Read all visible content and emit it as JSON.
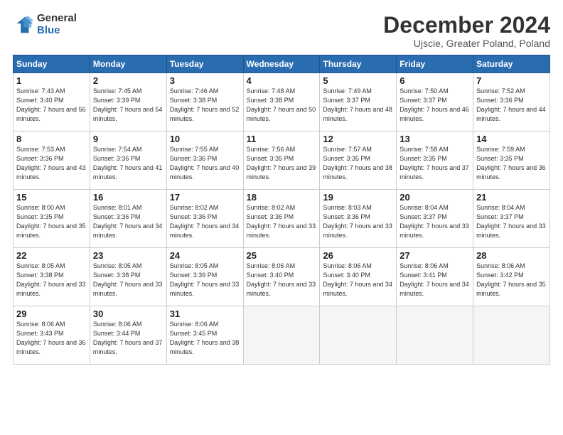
{
  "logo": {
    "general": "General",
    "blue": "Blue"
  },
  "title": "December 2024",
  "subtitle": "Ujscie, Greater Poland, Poland",
  "weekdays": [
    "Sunday",
    "Monday",
    "Tuesday",
    "Wednesday",
    "Thursday",
    "Friday",
    "Saturday"
  ],
  "weeks": [
    [
      {
        "day": "1",
        "sunrise": "7:43 AM",
        "sunset": "3:40 PM",
        "daylight": "7 hours and 56 minutes."
      },
      {
        "day": "2",
        "sunrise": "7:45 AM",
        "sunset": "3:39 PM",
        "daylight": "7 hours and 54 minutes."
      },
      {
        "day": "3",
        "sunrise": "7:46 AM",
        "sunset": "3:38 PM",
        "daylight": "7 hours and 52 minutes."
      },
      {
        "day": "4",
        "sunrise": "7:48 AM",
        "sunset": "3:38 PM",
        "daylight": "7 hours and 50 minutes."
      },
      {
        "day": "5",
        "sunrise": "7:49 AM",
        "sunset": "3:37 PM",
        "daylight": "7 hours and 48 minutes."
      },
      {
        "day": "6",
        "sunrise": "7:50 AM",
        "sunset": "3:37 PM",
        "daylight": "7 hours and 46 minutes."
      },
      {
        "day": "7",
        "sunrise": "7:52 AM",
        "sunset": "3:36 PM",
        "daylight": "7 hours and 44 minutes."
      }
    ],
    [
      {
        "day": "8",
        "sunrise": "7:53 AM",
        "sunset": "3:36 PM",
        "daylight": "7 hours and 43 minutes."
      },
      {
        "day": "9",
        "sunrise": "7:54 AM",
        "sunset": "3:36 PM",
        "daylight": "7 hours and 41 minutes."
      },
      {
        "day": "10",
        "sunrise": "7:55 AM",
        "sunset": "3:36 PM",
        "daylight": "7 hours and 40 minutes."
      },
      {
        "day": "11",
        "sunrise": "7:56 AM",
        "sunset": "3:35 PM",
        "daylight": "7 hours and 39 minutes."
      },
      {
        "day": "12",
        "sunrise": "7:57 AM",
        "sunset": "3:35 PM",
        "daylight": "7 hours and 38 minutes."
      },
      {
        "day": "13",
        "sunrise": "7:58 AM",
        "sunset": "3:35 PM",
        "daylight": "7 hours and 37 minutes."
      },
      {
        "day": "14",
        "sunrise": "7:59 AM",
        "sunset": "3:35 PM",
        "daylight": "7 hours and 36 minutes."
      }
    ],
    [
      {
        "day": "15",
        "sunrise": "8:00 AM",
        "sunset": "3:35 PM",
        "daylight": "7 hours and 35 minutes."
      },
      {
        "day": "16",
        "sunrise": "8:01 AM",
        "sunset": "3:36 PM",
        "daylight": "7 hours and 34 minutes."
      },
      {
        "day": "17",
        "sunrise": "8:02 AM",
        "sunset": "3:36 PM",
        "daylight": "7 hours and 34 minutes."
      },
      {
        "day": "18",
        "sunrise": "8:02 AM",
        "sunset": "3:36 PM",
        "daylight": "7 hours and 33 minutes."
      },
      {
        "day": "19",
        "sunrise": "8:03 AM",
        "sunset": "3:36 PM",
        "daylight": "7 hours and 33 minutes."
      },
      {
        "day": "20",
        "sunrise": "8:04 AM",
        "sunset": "3:37 PM",
        "daylight": "7 hours and 33 minutes."
      },
      {
        "day": "21",
        "sunrise": "8:04 AM",
        "sunset": "3:37 PM",
        "daylight": "7 hours and 33 minutes."
      }
    ],
    [
      {
        "day": "22",
        "sunrise": "8:05 AM",
        "sunset": "3:38 PM",
        "daylight": "7 hours and 33 minutes."
      },
      {
        "day": "23",
        "sunrise": "8:05 AM",
        "sunset": "3:38 PM",
        "daylight": "7 hours and 33 minutes."
      },
      {
        "day": "24",
        "sunrise": "8:05 AM",
        "sunset": "3:39 PM",
        "daylight": "7 hours and 33 minutes."
      },
      {
        "day": "25",
        "sunrise": "8:06 AM",
        "sunset": "3:40 PM",
        "daylight": "7 hours and 33 minutes."
      },
      {
        "day": "26",
        "sunrise": "8:06 AM",
        "sunset": "3:40 PM",
        "daylight": "7 hours and 34 minutes."
      },
      {
        "day": "27",
        "sunrise": "8:06 AM",
        "sunset": "3:41 PM",
        "daylight": "7 hours and 34 minutes."
      },
      {
        "day": "28",
        "sunrise": "8:06 AM",
        "sunset": "3:42 PM",
        "daylight": "7 hours and 35 minutes."
      }
    ],
    [
      {
        "day": "29",
        "sunrise": "8:06 AM",
        "sunset": "3:43 PM",
        "daylight": "7 hours and 36 minutes."
      },
      {
        "day": "30",
        "sunrise": "8:06 AM",
        "sunset": "3:44 PM",
        "daylight": "7 hours and 37 minutes."
      },
      {
        "day": "31",
        "sunrise": "8:06 AM",
        "sunset": "3:45 PM",
        "daylight": "7 hours and 38 minutes."
      },
      null,
      null,
      null,
      null
    ]
  ]
}
